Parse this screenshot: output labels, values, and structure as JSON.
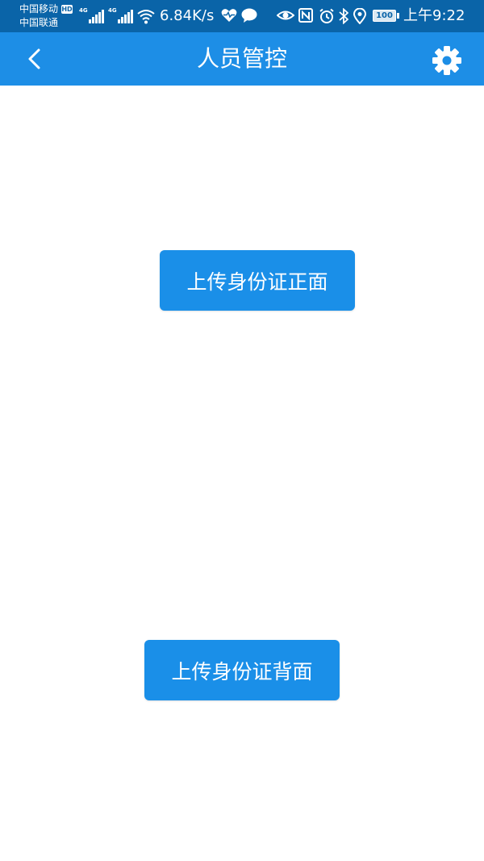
{
  "status_bar": {
    "carrier_1": "中国移动",
    "hd_label": "HD",
    "carrier_2": "中国联通",
    "network_1": "4G",
    "network_2": "4G",
    "net_speed": "6.84K/s",
    "battery_level": "100",
    "time": "上午9:22",
    "icons": [
      "signal-icon",
      "wifi-icon",
      "heart-rate-icon",
      "chat-icon",
      "eye-icon",
      "nfc-icon",
      "alarm-icon",
      "bluetooth-icon",
      "location-icon",
      "battery-icon"
    ]
  },
  "app_bar": {
    "title": "人员管控",
    "back_icon": "chevron-left-icon",
    "settings_icon": "gear-icon",
    "color": "#1d8ee6"
  },
  "content": {
    "upload_front_label": "上传身份证正面",
    "upload_back_label": "上传身份证背面",
    "button_color": "#1a8fe8"
  },
  "colors": {
    "status_bar": "#0a64a8",
    "background": "#ffffff"
  }
}
